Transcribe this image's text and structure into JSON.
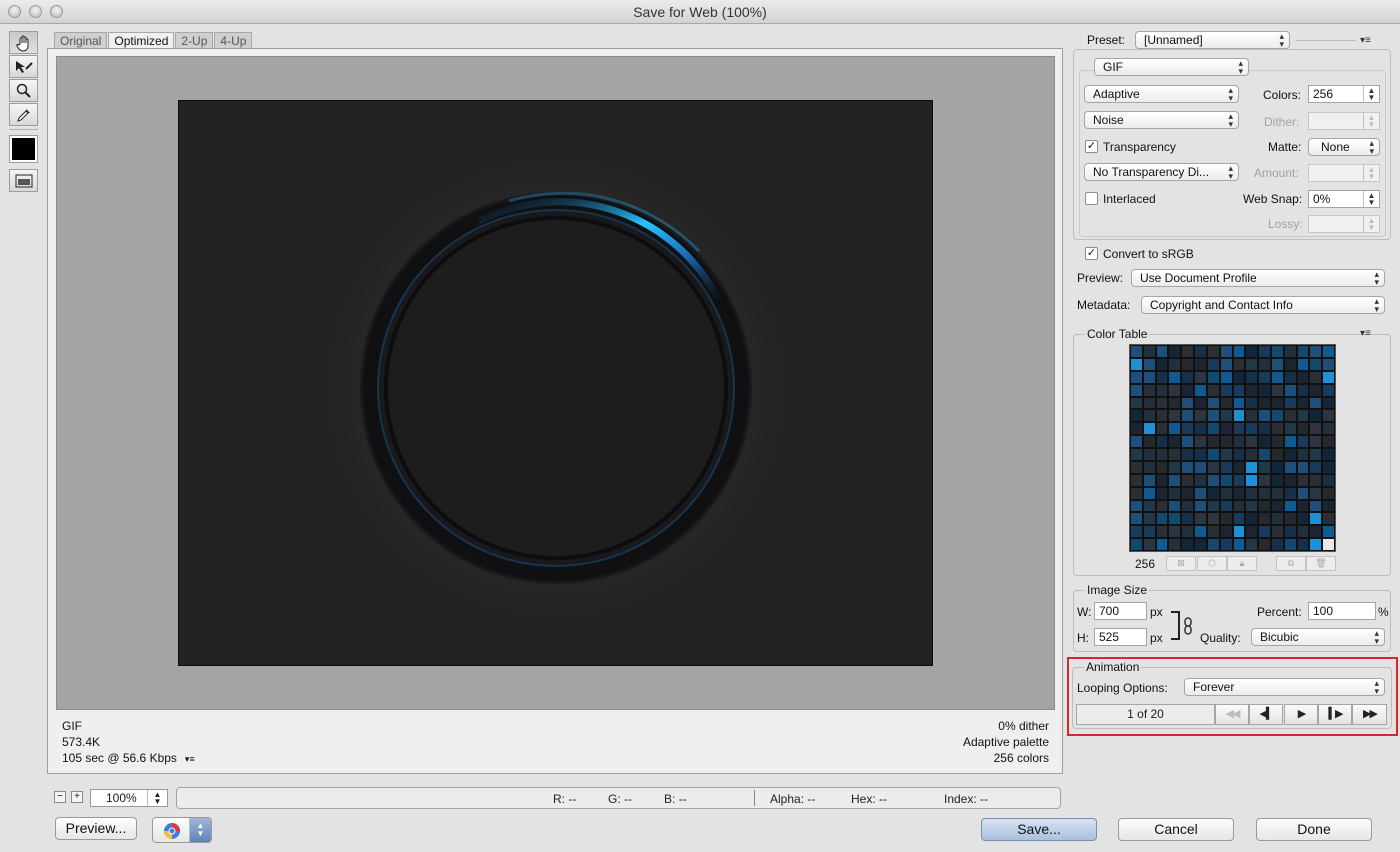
{
  "window": {
    "title": "Save for Web (100%)"
  },
  "tabs": [
    "Original",
    "Optimized",
    "2-Up",
    "4-Up"
  ],
  "tools": [
    "hand-tool",
    "slice-select-tool",
    "zoom-tool",
    "eyedropper-tool",
    "eyedropper-color",
    "toggle-slices"
  ],
  "image_info": {
    "format": "GIF",
    "size": "573.4K",
    "download": "105 sec @ 56.6 Kbps",
    "dither": "0% dither",
    "palette": "Adaptive palette",
    "colors": "256 colors"
  },
  "status": {
    "zoom": "100%",
    "r_label": "R:",
    "r_value": "--",
    "g_label": "G:",
    "g_value": "--",
    "b_label": "B:",
    "b_value": "--",
    "alpha_label": "Alpha:",
    "alpha_value": "--",
    "hex_label": "Hex:",
    "hex_value": "--",
    "index_label": "Index:",
    "index_value": "--"
  },
  "buttons": {
    "preview": "Preview...",
    "save": "Save...",
    "cancel": "Cancel",
    "done": "Done"
  },
  "settings": {
    "preset_label": "Preset:",
    "preset_value": "[Unnamed]",
    "format_value": "GIF",
    "reduction_value": "Adaptive",
    "colors_label": "Colors:",
    "colors_value": "256",
    "dither_algorithm": "Noise",
    "dither_label": "Dither:",
    "transparency_label": "Transparency",
    "transparency_checked": true,
    "matte_label": "Matte:",
    "matte_value": "None",
    "transparency_dither": "No Transparency Di...",
    "amount_label": "Amount:",
    "interlaced_label": "Interlaced",
    "interlaced_checked": false,
    "websnap_label": "Web Snap:",
    "websnap_value": "0%",
    "lossy_label": "Lossy:",
    "convert_srgb_label": "Convert to sRGB",
    "convert_srgb_checked": true,
    "preview_label": "Preview:",
    "preview_value": "Use Document Profile",
    "metadata_label": "Metadata:",
    "metadata_value": "Copyright and Contact Info"
  },
  "color_table": {
    "title": "Color Table",
    "count": "256"
  },
  "image_size": {
    "title": "Image Size",
    "w_label": "W:",
    "w_value": "700",
    "h_label": "H:",
    "h_value": "525",
    "unit": "px",
    "percent_label": "Percent:",
    "percent_value": "100",
    "percent_sign": "%",
    "quality_label": "Quality:",
    "quality_value": "Bicubic"
  },
  "animation": {
    "title": "Animation",
    "looping_label": "Looping Options:",
    "looping_value": "Forever",
    "frame_counter": "1 of 20"
  },
  "colors": {
    "highlight": "#d8262b",
    "artwork_bg": "#222223",
    "accent_cyan": "#27c3ff"
  }
}
